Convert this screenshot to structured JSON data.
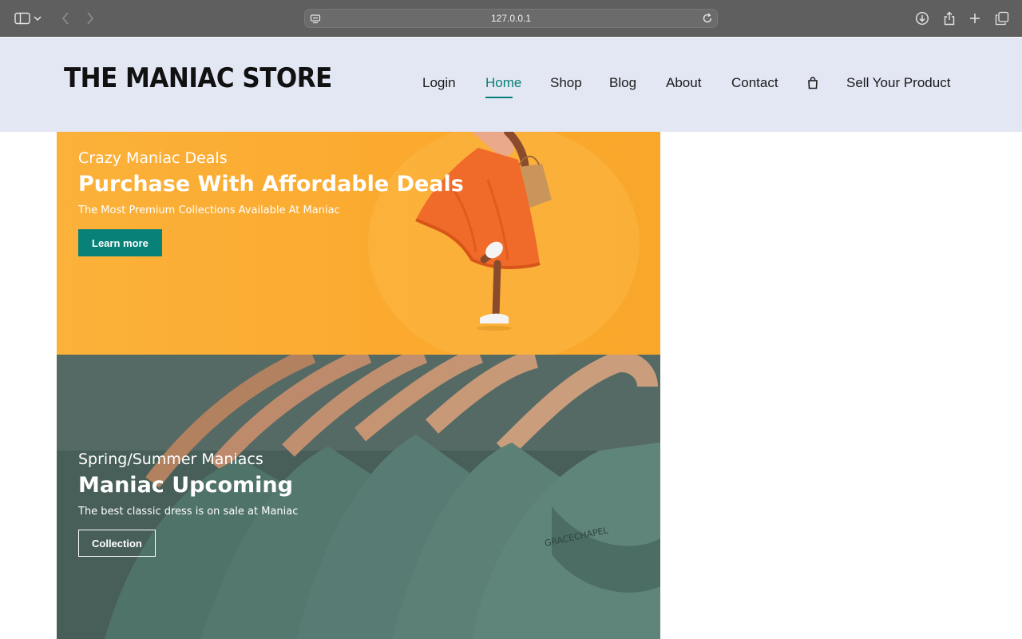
{
  "browser": {
    "url": "127.0.0.1",
    "icons": [
      "sidebar-icon",
      "chevron-down-icon",
      "back-icon",
      "forward-icon",
      "site-settings-icon",
      "reload-icon",
      "download-icon",
      "share-icon",
      "new-tab-icon",
      "tabs-overview-icon"
    ]
  },
  "header": {
    "logo": "THE MANIAC STORE",
    "nav": [
      {
        "label": "Login"
      },
      {
        "label": "Home",
        "active": true
      },
      {
        "label": "Shop"
      },
      {
        "label": "Blog"
      },
      {
        "label": "About"
      },
      {
        "label": "Contact"
      },
      {
        "label": "",
        "icon": "shopping-bag-icon"
      },
      {
        "label": "Sell Your Product"
      }
    ]
  },
  "banners": [
    {
      "subtitle": "Crazy Maniac Deals",
      "title": "Purchase With Affordable Deals",
      "text": "The Most Premium Collections Available At Maniac",
      "button": "Learn more"
    },
    {
      "subtitle": "Spring/Summer Maniacs",
      "title": "Maniac Upcoming",
      "text": "The best classic dress is on sale at Maniac",
      "button": "Collection"
    }
  ],
  "colors": {
    "accent": "#088178",
    "header_bg": "#e3e6f3",
    "banner1_bg": "#fbb13a",
    "banner2_bg": "#4f6a62"
  }
}
